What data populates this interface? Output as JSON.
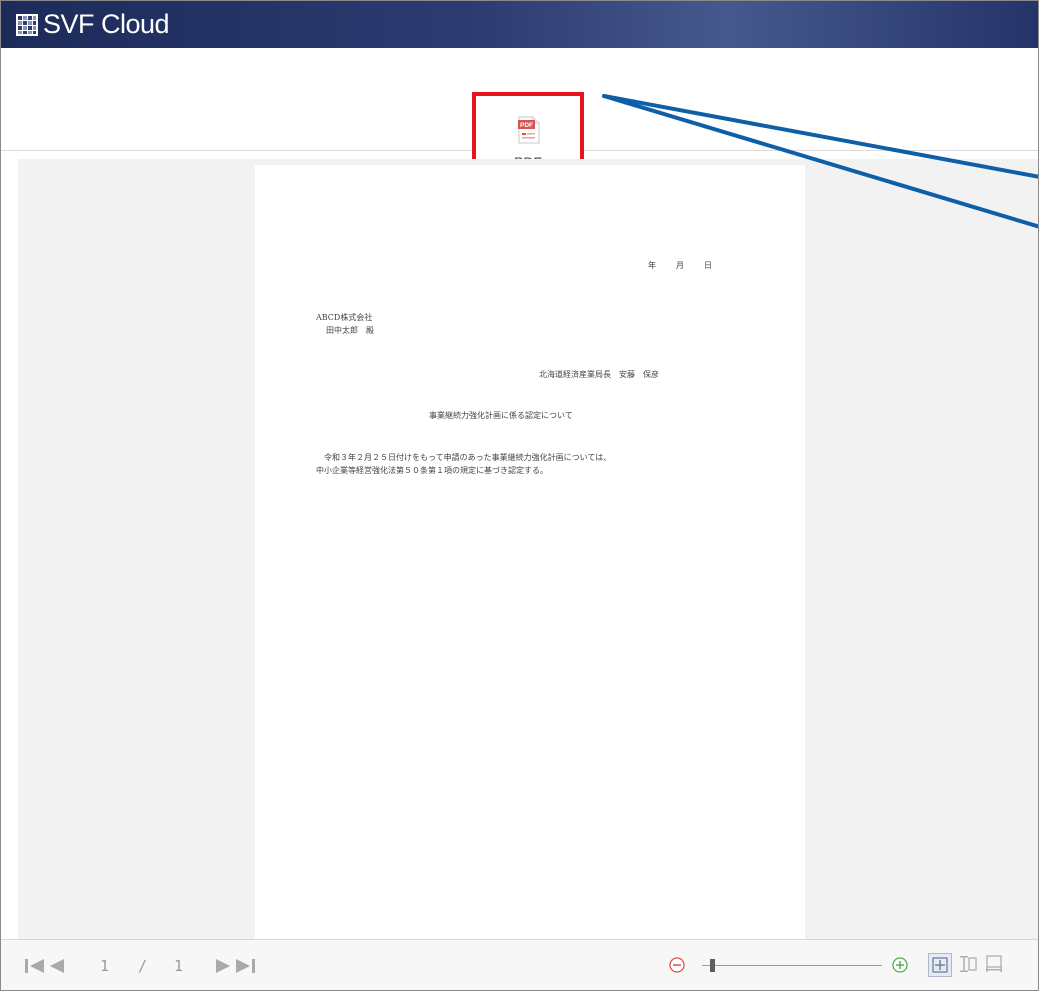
{
  "app": {
    "title": "SVF Cloud"
  },
  "toolbar": {
    "pdf_label": "PDF"
  },
  "document": {
    "date_line": "年　月　日",
    "recipient_company": "ABCD株式会社",
    "recipient_name": "田中太郎　殿",
    "sender": "北海道経済産業局長　安藤　保彦",
    "subject": "事業継続力強化計画に係る認定について",
    "body_line1": "令和３年２月２５日付けをもって申請のあった事業継続力強化計画については、",
    "body_line2": "中小企業等経営強化法第５０条第１項の規定に基づき認定する。"
  },
  "pager": {
    "current": "1",
    "separator": "/",
    "total": "1"
  },
  "zoom": {
    "level": 0.05
  },
  "icons": {
    "app_logo": "grid-logo-icon",
    "pdf": "pdf-file-icon",
    "first": "first-page-icon",
    "prev": "prev-page-icon",
    "next": "next-page-icon",
    "last": "last-page-icon",
    "zoom_out": "zoom-out-icon",
    "zoom_in": "zoom-in-icon",
    "fit_page": "fit-page-icon",
    "fit_height": "fit-height-icon",
    "fit_width": "fit-width-icon"
  },
  "colors": {
    "titlebar": "#2c3b71",
    "highlight": "#e8141d",
    "callout_line": "#0f5ea8",
    "icon_red": "#d9534f",
    "icon_green": "#4caf50"
  }
}
